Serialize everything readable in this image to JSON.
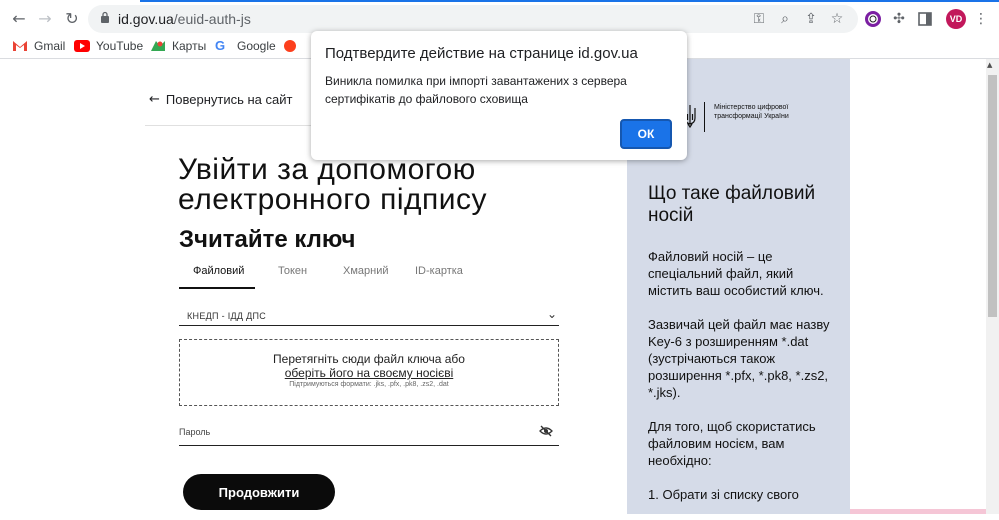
{
  "browser": {
    "url_host": "id.gov.ua",
    "url_path": "/euid-auth-js",
    "avatar_initials": "VD",
    "accent": "#1a73e8"
  },
  "bookmarks": [
    {
      "label": "Gmail",
      "icon": "gmail-icon"
    },
    {
      "label": "YouTube",
      "icon": "youtube-icon"
    },
    {
      "label": "Карты",
      "icon": "maps-icon"
    },
    {
      "label": "Google",
      "icon": "google-icon"
    },
    {
      "label": "Я",
      "icon": "yandex-icon"
    }
  ],
  "page": {
    "back_label": "Повернутись на сайт",
    "title": "Увійти за допомогою електронного підпису",
    "subtitle": "Зчитайте ключ",
    "tabs": [
      "Файловий",
      "Токен",
      "Хмарний",
      "ID-картка"
    ],
    "active_tab": "Файловий",
    "ca_select": "КНЕДП - ІДД ДПС",
    "dropzone": {
      "line1": "Перетягніть сюди файл ключа або",
      "link": "оберіть його на своєму носієві",
      "formats": "Підтримуються формати: .jks, .pfx, .pk8, .zs2, .dat"
    },
    "password_placeholder": "Пароль",
    "continue_label": "Продовжити"
  },
  "side": {
    "ministry": "Міністерство цифрової трансформації України",
    "title": "Що таке файловий носій",
    "paragraphs": [
      "Файловий носій – це спеціальний файл, який містить ваш особистий ключ.",
      "Зазвичай цей файл має назву Key-6 з розширенням *.dat (зустрічаються також розширення *.pfx, *.pk8, *.zs2, *.jks).",
      "Для того, щоб скористатись файловим носієм, вам необхідно:",
      "1. Обрати зі списку свого"
    ],
    "background": "#d5dbe8"
  },
  "dialog": {
    "title": "Подтвердите действие на странице id.gov.ua",
    "message": "Виникла помилка при імпорті завантажених з сервера сертифікатів до файлового сховища",
    "ok_label": "ОК"
  }
}
